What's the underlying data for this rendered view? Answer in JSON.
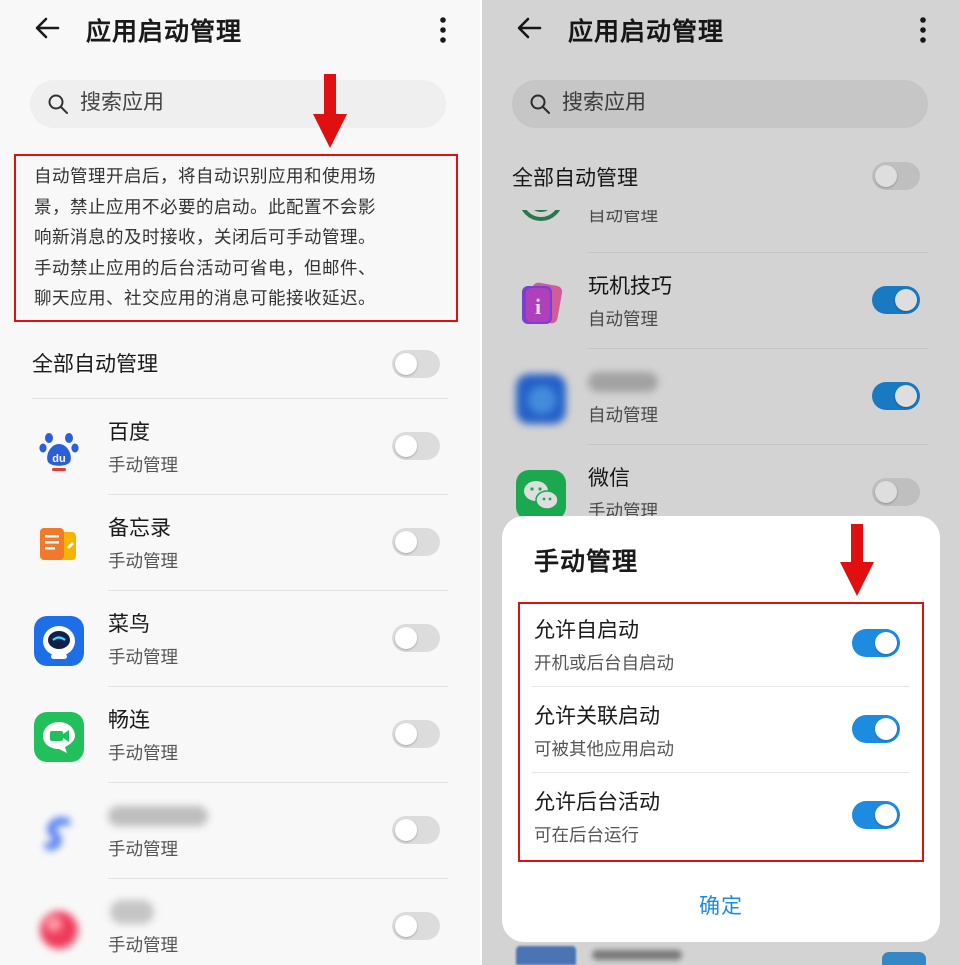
{
  "left": {
    "header": {
      "title": "应用启动管理"
    },
    "search": {
      "placeholder": "搜索应用"
    },
    "notice": {
      "lines": [
        "自动管理开启后，将自动识别应用和使用场",
        "景，禁止应用不必要的启动。此配置不会影",
        "响新消息的及时接收，关闭后可手动管理。",
        "手动禁止应用的后台活动可省电，但邮件、",
        "聊天应用、社交应用的消息可能接收延迟。"
      ]
    },
    "all_auto": {
      "label": "全部自动管理",
      "on": false
    },
    "apps": [
      {
        "name": "百度",
        "mode": "手动管理",
        "icon": "baidu-icon",
        "on": false
      },
      {
        "name": "备忘录",
        "mode": "手动管理",
        "icon": "memo-icon",
        "on": false
      },
      {
        "name": "菜鸟",
        "mode": "手动管理",
        "icon": "cainiao-icon",
        "on": false
      },
      {
        "name": "畅连",
        "mode": "手动管理",
        "icon": "changlian-icon",
        "on": false
      },
      {
        "name": "",
        "mode": "手动管理",
        "icon": "blurred-app-icon",
        "on": false
      },
      {
        "name": "",
        "mode": "手动管理",
        "icon": "blurred-app-icon",
        "on": false
      }
    ]
  },
  "right": {
    "header": {
      "title": "应用启动管理"
    },
    "search": {
      "placeholder": "搜索应用"
    },
    "all_auto": {
      "label": "全部自动管理",
      "on": false
    },
    "apps": [
      {
        "name": "",
        "mode": "自动管理",
        "icon": "partial-app-icon",
        "on": true
      },
      {
        "name": "玩机技巧",
        "mode": "自动管理",
        "icon": "tips-icon",
        "on": true
      },
      {
        "name": "",
        "mode": "自动管理",
        "icon": "blurred-app-icon",
        "on": true
      },
      {
        "name": "微信",
        "mode": "手动管理",
        "icon": "wechat-icon",
        "on": false
      }
    ],
    "sheet": {
      "title": "手动管理",
      "options": [
        {
          "title": "允许自启动",
          "desc": "开机或后台自启动",
          "on": true
        },
        {
          "title": "允许关联启动",
          "desc": "可被其他应用启动",
          "on": true
        },
        {
          "title": "允许后台活动",
          "desc": "可在后台运行",
          "on": true
        }
      ],
      "confirm": "确定"
    }
  },
  "colors": {
    "accent": "#1d8ce0",
    "highlight": "#dd1111",
    "toggle_off": "#dcdcdc"
  }
}
